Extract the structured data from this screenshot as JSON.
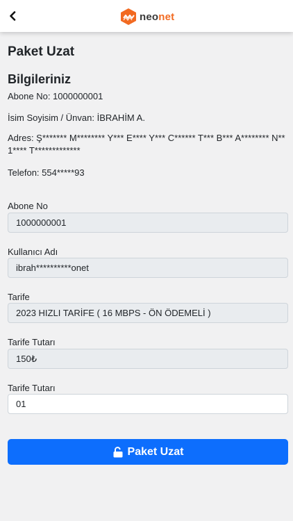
{
  "header": {
    "back_icon": "chevron-left-icon",
    "logo_icon": "neonet-hexagon-logo",
    "logo_text_a": "neo",
    "logo_text_b": "net",
    "brand_color": "#f26a21"
  },
  "page": {
    "title": "Paket Uzat",
    "section_title": "Bilgileriniz"
  },
  "info": {
    "abone_no": "Abone No: 1000000001",
    "isim": "İsim Soyisim / Ünvan: İBRAHİM A.",
    "adres": "Adres: Ş******* M******** Y*** E**** Y*** C****** T*** B*** A******** N** 1**** T*************",
    "telefon": "Telefon: 554*****93"
  },
  "form": {
    "abone_no_label": "Abone No",
    "abone_no_value": "1000000001",
    "kullanici_label": "Kullanıcı Adı",
    "kullanici_value": "ibrah**********onet",
    "tarife_label": "Tarife",
    "tarife_value": "2023 HIZLI TARİFE ( 16 MBPS - ÖN ÖDEMELİ )",
    "tutar_label": "Tarife Tutarı",
    "tutar_value": "150₺",
    "tutar2_label": "Tarife Tutarı",
    "tutar2_value": "01"
  },
  "submit": {
    "label": "Paket Uzat",
    "icon": "unlock-icon",
    "color": "#0d6efd"
  }
}
